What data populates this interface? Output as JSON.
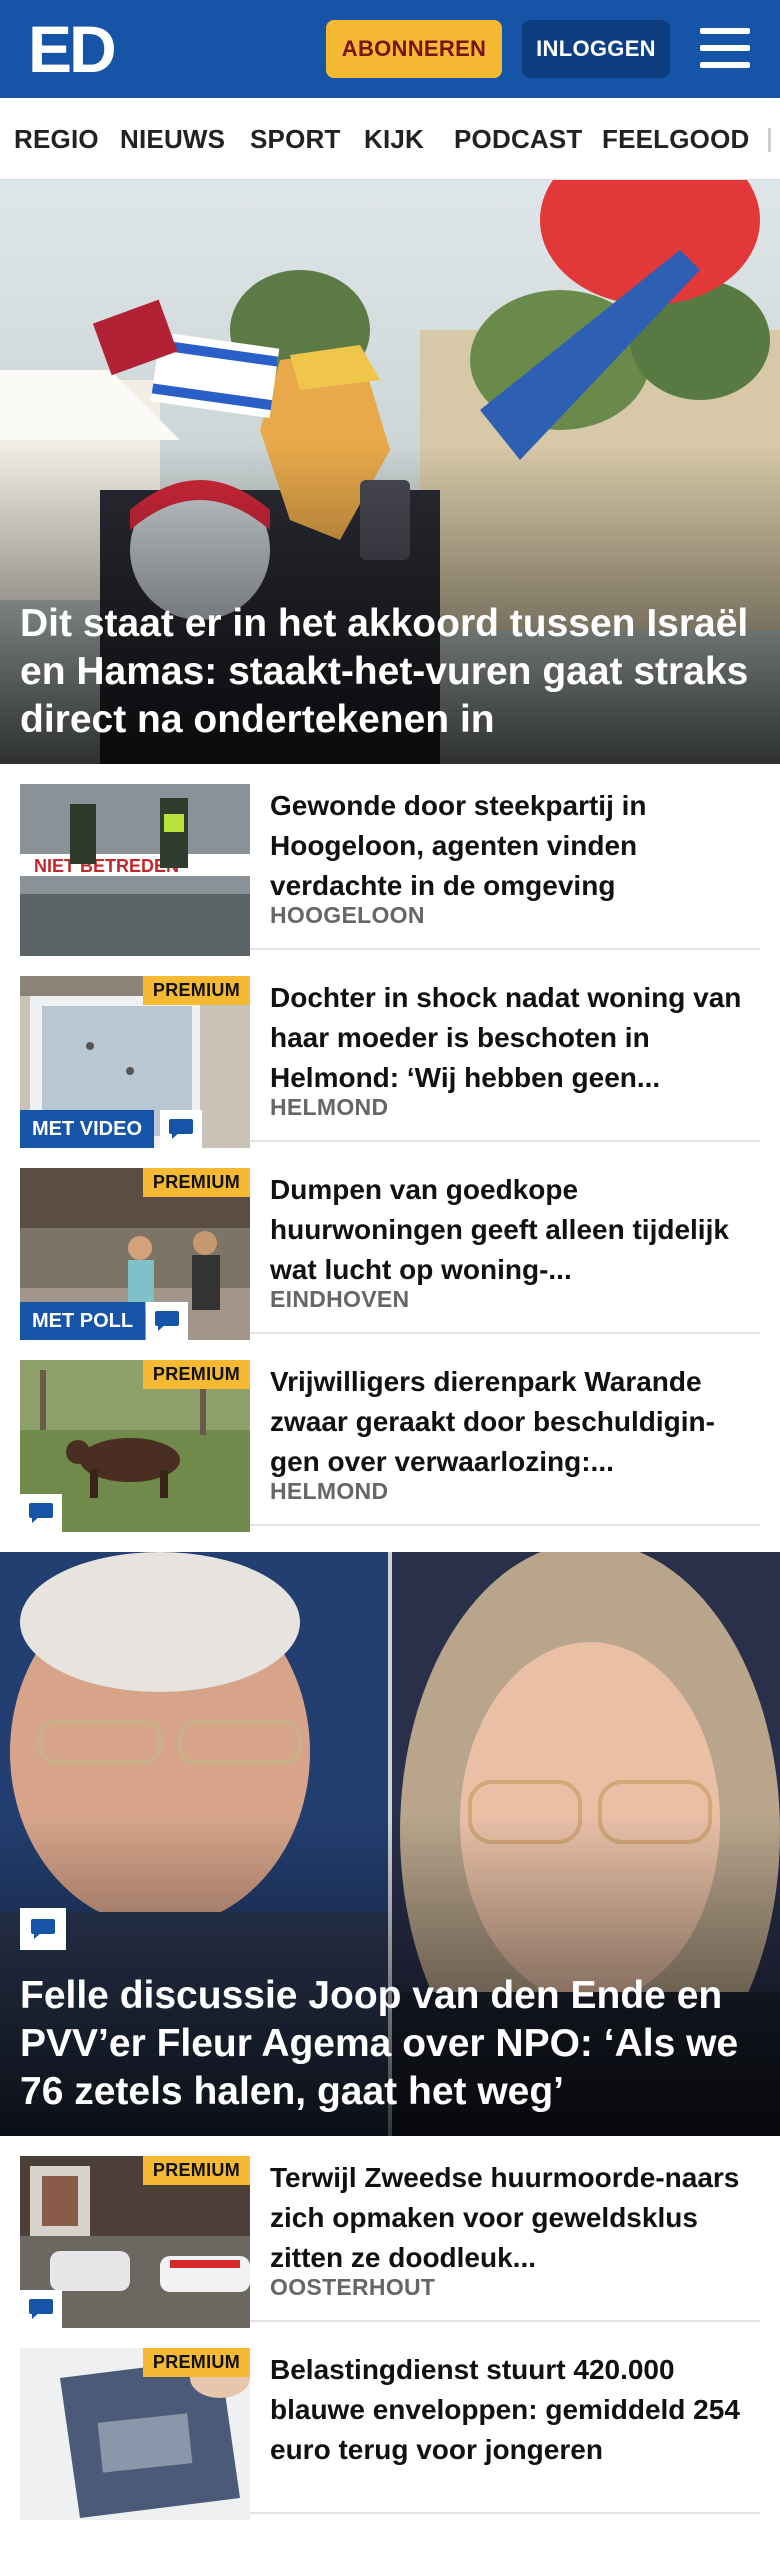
{
  "header": {
    "logo_text": "ED",
    "subscribe_label": "ABONNEREN",
    "login_label": "INLOGGEN",
    "brand_color": "#1654a7",
    "accent_color": "#f5b933",
    "menu_icon": "hamburger-icon"
  },
  "nav": {
    "items": [
      "REGIO",
      "NIEUWS",
      "SPORT",
      "KIJK",
      "PODCAST",
      "FEELGOOD"
    ]
  },
  "hero1": {
    "title": "Dit staat er in het akkoord tussen Israël en Hamas: staakt-het-vuren gaat straks direct na ondertekenen in"
  },
  "articles1": [
    {
      "title": "Gewonde door steekpartij in Hoogeloon, agenten vinden verdachte in de omgeving",
      "location": "HOOGELOON",
      "premium": "",
      "media": "",
      "comment": false
    },
    {
      "title": "Dochter in shock nadat woning van haar moeder is beschoten in Helmond: ‘Wij hebben geen...",
      "location": "HELMOND",
      "premium": "PREMIUM",
      "media": "MET VIDEO",
      "comment": true
    },
    {
      "title": "Dumpen van goedkope huurwoningen geeft alleen tijdelijk wat lucht op woning-...",
      "location": "EINDHOVEN",
      "premium": "PREMIUM",
      "media": "MET POLL",
      "comment": true
    },
    {
      "title": "Vrijwilligers dierenpark Warande zwaar geraakt door beschuldigin-gen over verwaarlozing:...",
      "location": "HELMOND",
      "premium": "PREMIUM",
      "media": "",
      "comment": true
    }
  ],
  "hero2": {
    "title": "Felle discussie Joop van den Ende en PVV’er Fleur Agema over NPO: ‘Als we 76 zetels halen, gaat het weg’"
  },
  "articles2": [
    {
      "title": "Terwijl Zweedse huurmoorde-naars zich opmaken voor geweldsklus zitten ze doodleuk...",
      "location": "OOSTERHOUT",
      "premium": "PREMIUM",
      "media": "",
      "comment": true
    },
    {
      "title": "Belastingdienst stuurt 420.000 blauwe enveloppen: gemiddeld 254 euro terug voor jongeren",
      "location": "",
      "premium": "PREMIUM",
      "media": "",
      "comment": false
    }
  ]
}
